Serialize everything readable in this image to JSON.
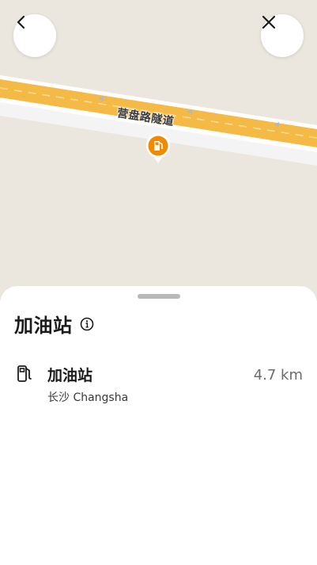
{
  "map": {
    "road_name": "营盘路隧道",
    "colors": {
      "background": "#ebe7df",
      "road_fill": "#f5b945",
      "road_edge": "#f2f2f2",
      "pin": "#f08a00"
    }
  },
  "nav": {
    "back_icon": "chevron-left-icon",
    "close_icon": "close-icon"
  },
  "sheet": {
    "title": "加油站",
    "results": [
      {
        "icon": "fuel-pump-icon",
        "name": "加油站",
        "subtitle": "长沙 Changsha",
        "distance": "4.7 km"
      }
    ]
  }
}
